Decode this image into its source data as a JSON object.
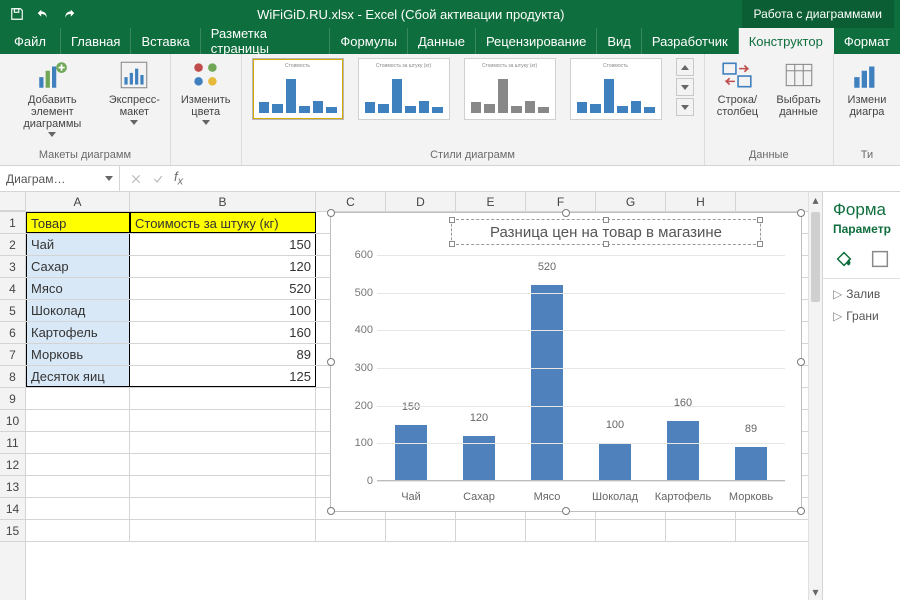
{
  "titlebar": {
    "doc": "WiFiGiD.RU.xlsx - Excel (Сбой активации продукта)",
    "context": "Работа с диаграммами"
  },
  "tabs": {
    "file": "Файл",
    "list": [
      "Главная",
      "Вставка",
      "Разметка страницы",
      "Формулы",
      "Данные",
      "Рецензирование",
      "Вид",
      "Разработчик"
    ],
    "ctx": [
      "Конструктор",
      "Формат"
    ],
    "active": "Конструктор"
  },
  "ribbon": {
    "group_layouts": "Макеты диаграмм",
    "btn_add_elem": "Добавить элемент диаграммы",
    "btn_express": "Экспресс-макет",
    "btn_colors": "Изменить цвета",
    "group_styles": "Стили диаграмм",
    "btn_switch": "Строка/столбец",
    "btn_select_data": "Выбрать данные",
    "group_data": "Данные",
    "btn_change_type": "Измени диагра",
    "group_type": "Ти"
  },
  "namebox": "Диаграм…",
  "columns": [
    "A",
    "B",
    "C",
    "D",
    "E",
    "F",
    "G",
    "H"
  ],
  "table": {
    "hdr_a": "Товар",
    "hdr_b": "Стоимость за штуку (кг)",
    "rows": [
      {
        "a": "Чай",
        "b": 150
      },
      {
        "a": "Сахар",
        "b": 120
      },
      {
        "a": "Мясо",
        "b": 520
      },
      {
        "a": "Шоколад",
        "b": 100
      },
      {
        "a": "Картофель",
        "b": 160
      },
      {
        "a": "Морковь",
        "b": 89
      },
      {
        "a": "Десяток яиц",
        "b": 125
      }
    ]
  },
  "chart_data": {
    "type": "bar",
    "title": "Разница цен на товар в магазине",
    "categories": [
      "Чай",
      "Сахар",
      "Мясо",
      "Шоколад",
      "Картофель",
      "Морковь"
    ],
    "values": [
      150,
      120,
      520,
      100,
      160,
      89
    ],
    "ylim": [
      0,
      600
    ],
    "yticks": [
      0,
      100,
      200,
      300,
      400,
      500,
      600
    ],
    "xlabel": "",
    "ylabel": ""
  },
  "format_pane": {
    "title": "Форма",
    "subtitle": "Параметр",
    "fill": "Залив",
    "border": "Грани"
  }
}
